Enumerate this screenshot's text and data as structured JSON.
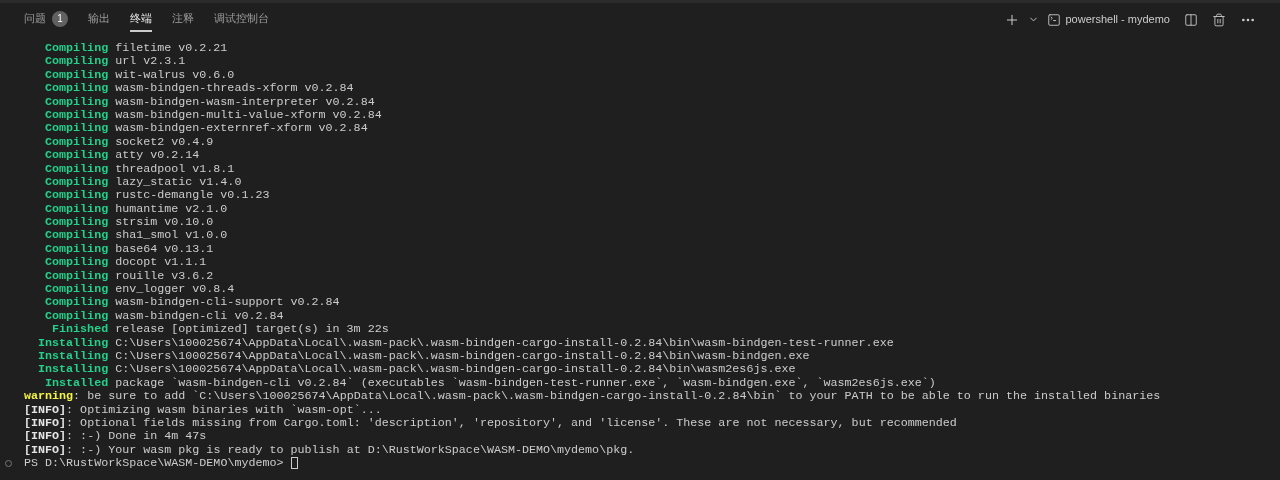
{
  "tabs": [
    {
      "label": "问题",
      "badge": "1",
      "selected": false
    },
    {
      "label": "输出",
      "selected": false
    },
    {
      "label": "终端",
      "selected": true
    },
    {
      "label": "注释",
      "selected": false
    },
    {
      "label": "调试控制台",
      "selected": false
    }
  ],
  "terminal_name": "powershell - mydemo",
  "lines": [
    {
      "kind": "cargo",
      "label": "Compiling",
      "text": "filetime v0.2.21"
    },
    {
      "kind": "cargo",
      "label": "Compiling",
      "text": "url v2.3.1"
    },
    {
      "kind": "cargo",
      "label": "Compiling",
      "text": "wit-walrus v0.6.0"
    },
    {
      "kind": "cargo",
      "label": "Compiling",
      "text": "wasm-bindgen-threads-xform v0.2.84"
    },
    {
      "kind": "cargo",
      "label": "Compiling",
      "text": "wasm-bindgen-wasm-interpreter v0.2.84"
    },
    {
      "kind": "cargo",
      "label": "Compiling",
      "text": "wasm-bindgen-multi-value-xform v0.2.84"
    },
    {
      "kind": "cargo",
      "label": "Compiling",
      "text": "wasm-bindgen-externref-xform v0.2.84"
    },
    {
      "kind": "cargo",
      "label": "Compiling",
      "text": "socket2 v0.4.9"
    },
    {
      "kind": "cargo",
      "label": "Compiling",
      "text": "atty v0.2.14"
    },
    {
      "kind": "cargo",
      "label": "Compiling",
      "text": "threadpool v1.8.1"
    },
    {
      "kind": "cargo",
      "label": "Compiling",
      "text": "lazy_static v1.4.0"
    },
    {
      "kind": "cargo",
      "label": "Compiling",
      "text": "rustc-demangle v0.1.23"
    },
    {
      "kind": "cargo",
      "label": "Compiling",
      "text": "humantime v2.1.0"
    },
    {
      "kind": "cargo",
      "label": "Compiling",
      "text": "strsim v0.10.0"
    },
    {
      "kind": "cargo",
      "label": "Compiling",
      "text": "sha1_smol v1.0.0"
    },
    {
      "kind": "cargo",
      "label": "Compiling",
      "text": "base64 v0.13.1"
    },
    {
      "kind": "cargo",
      "label": "Compiling",
      "text": "docopt v1.1.1"
    },
    {
      "kind": "cargo",
      "label": "Compiling",
      "text": "rouille v3.6.2"
    },
    {
      "kind": "cargo",
      "label": "Compiling",
      "text": "env_logger v0.8.4"
    },
    {
      "kind": "cargo",
      "label": "Compiling",
      "text": "wasm-bindgen-cli-support v0.2.84"
    },
    {
      "kind": "cargo",
      "label": "Compiling",
      "text": "wasm-bindgen-cli v0.2.84"
    },
    {
      "kind": "cargo",
      "label": "Finished",
      "text": "release [optimized] target(s) in 3m 22s"
    },
    {
      "kind": "cargo",
      "label": "Installing",
      "text": "C:\\Users\\100025674\\AppData\\Local\\.wasm-pack\\.wasm-bindgen-cargo-install-0.2.84\\bin\\wasm-bindgen-test-runner.exe"
    },
    {
      "kind": "cargo",
      "label": "Installing",
      "text": "C:\\Users\\100025674\\AppData\\Local\\.wasm-pack\\.wasm-bindgen-cargo-install-0.2.84\\bin\\wasm-bindgen.exe"
    },
    {
      "kind": "cargo",
      "label": "Installing",
      "text": "C:\\Users\\100025674\\AppData\\Local\\.wasm-pack\\.wasm-bindgen-cargo-install-0.2.84\\bin\\wasm2es6js.exe"
    },
    {
      "kind": "cargo",
      "label": "Installed",
      "text": "package `wasm-bindgen-cli v0.2.84` (executables `wasm-bindgen-test-runner.exe`, `wasm-bindgen.exe`, `wasm2es6js.exe`)"
    },
    {
      "kind": "warning",
      "label": "warning",
      "text": ": be sure to add `C:\\Users\\100025674\\AppData\\Local\\.wasm-pack\\.wasm-bindgen-cargo-install-0.2.84\\bin` to your PATH to be able to run the installed binaries"
    },
    {
      "kind": "info",
      "label": "[INFO]",
      "text": ": Optimizing wasm binaries with `wasm-opt`..."
    },
    {
      "kind": "info",
      "label": "[INFO]",
      "text": ": Optional fields missing from Cargo.toml: 'description', 'repository', and 'license'. These are not necessary, but recommended"
    },
    {
      "kind": "info",
      "label": "[INFO]",
      "text": ": :-) Done in 4m 47s"
    },
    {
      "kind": "info",
      "label": "[INFO]",
      "text": ": :-) Your wasm pkg is ready to publish at D:\\RustWorkSpace\\WASM-DEMO\\mydemo\\pkg."
    },
    {
      "kind": "prompt",
      "text": "PS D:\\RustWorkSpace\\WASM-DEMO\\mydemo>"
    }
  ]
}
